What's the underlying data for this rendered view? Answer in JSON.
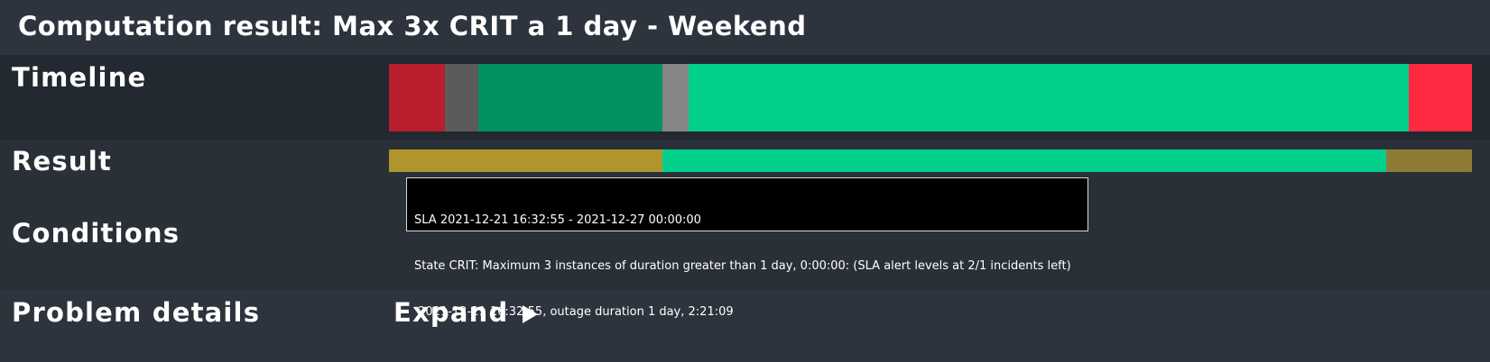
{
  "header": {
    "title": "Computation result: Max 3x CRIT a 1 day - Weekend"
  },
  "rows": {
    "timeline": {
      "label": "Timeline",
      "segments": [
        {
          "state": "crit",
          "color": "#bb1e2c",
          "fraction": 0.0517
        },
        {
          "state": "unknown",
          "color": "#5b5b5b",
          "fraction": 0.0308
        },
        {
          "state": "ok",
          "color": "#00925f",
          "fraction": 0.17
        },
        {
          "state": "downtime",
          "color": "#868686",
          "fraction": 0.0242
        },
        {
          "state": "ok",
          "color": "#00d08c",
          "fraction": 0.665
        },
        {
          "state": "crit",
          "color": "#ff2a42",
          "fraction": 0.0583
        }
      ]
    },
    "result": {
      "label": "Result",
      "segments": [
        {
          "state": "warn",
          "color": "#b0952e",
          "fraction": 0.2525
        },
        {
          "state": "ok",
          "color": "#00d08c",
          "fraction": 0.6683
        },
        {
          "state": "warn",
          "color": "#8c7c33",
          "fraction": 0.0792
        }
      ]
    },
    "conditions": {
      "label": "Conditions"
    },
    "problem_details": {
      "label": "Problem details",
      "expand_label": "Expand",
      "expand_icon": "triangle-right-icon"
    }
  },
  "tooltip": {
    "line1": "SLA 2021-12-21 16:32:55 - 2021-12-27 00:00:00",
    "line2": "State CRIT: Maximum 3 instances of duration greater than 1 day, 0:00:00: (SLA alert levels at 2/1 incidents left)",
    "line3": " 2021-12-21 16:32:55, outage duration 1 day, 2:21:09"
  }
}
